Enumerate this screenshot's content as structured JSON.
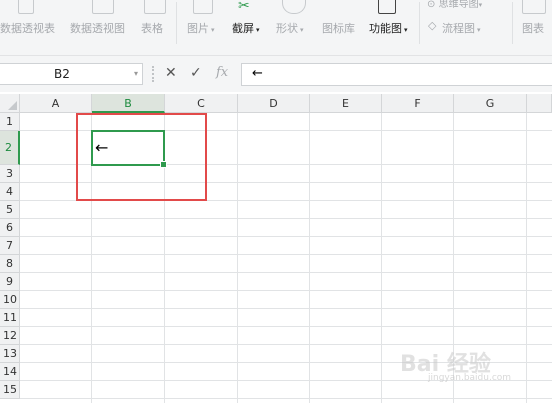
{
  "ribbon": {
    "items": [
      {
        "label": "数据透视表",
        "active": false
      },
      {
        "label": "数据透视图",
        "active": false
      },
      {
        "label": "表格",
        "active": false
      },
      {
        "label": "图片",
        "active": false,
        "caret": "▾"
      },
      {
        "label": "截屏",
        "active": true,
        "caret": "▾"
      },
      {
        "label": "形状",
        "active": false,
        "caret": "▾"
      },
      {
        "label": "图标库",
        "active": false
      },
      {
        "label": "功能图",
        "active": true,
        "caret": "▾"
      },
      {
        "label": "流程图",
        "active": false,
        "caret": "▾"
      },
      {
        "label": "思维导图",
        "active": false,
        "caret": "▾"
      },
      {
        "label": "图表",
        "active": false
      }
    ]
  },
  "formula_bar": {
    "name_box": "B2",
    "name_box_dropdown": "▾",
    "cancel": "✕",
    "confirm": "✓",
    "fx": "fx",
    "content": "←"
  },
  "sheet": {
    "columns": [
      "A",
      "B",
      "C",
      "D",
      "E",
      "F",
      "G"
    ],
    "rows": [
      "1",
      "2",
      "3",
      "4",
      "5",
      "6",
      "7",
      "8",
      "9",
      "10",
      "11",
      "12",
      "13",
      "14",
      "15"
    ],
    "selected_column": "B",
    "selected_row": "2",
    "active_cell": "B2",
    "active_cell_value": "←"
  },
  "annotation": {
    "color": "#e24a4a"
  },
  "accent_color": "#2f9a4e",
  "watermark": {
    "text": "Bai 经验",
    "subtext": "jingyan.baidu.com"
  }
}
